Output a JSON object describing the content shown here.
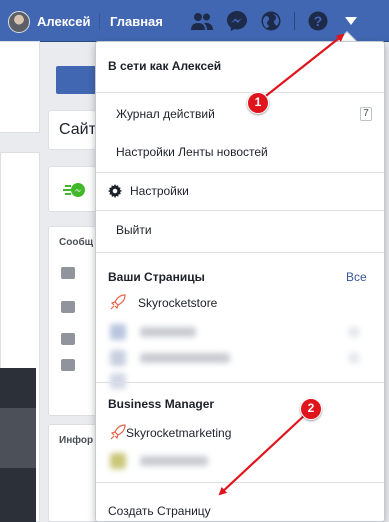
{
  "topbar": {
    "user_name": "Алексей",
    "home_label": "Главная",
    "icons": [
      "friends-icon",
      "messenger-icon",
      "globe-icon",
      "help-icon",
      "caret-down-icon"
    ]
  },
  "background": {
    "search_stub": "Сайт",
    "card_messages_stub": "Сообщ",
    "card_info_stub": "Инфор"
  },
  "menu": {
    "header": "В сети как Алексей",
    "items": [
      {
        "label": "Журнал действий",
        "badge": "7"
      },
      {
        "label": "Настройки Ленты новостей"
      },
      {
        "label": "Настройки",
        "icon": "gear-icon"
      },
      {
        "label": "Выйти"
      }
    ],
    "pages_section": {
      "title": "Ваши Страницы",
      "all_link": "Все",
      "pages": [
        {
          "name": "Skyrocketstore",
          "icon": "rocket-icon"
        }
      ]
    },
    "business_section": {
      "title": "Business Manager",
      "pages": [
        {
          "name": "Skyrocketmarketing",
          "icon": "rocket-icon"
        }
      ]
    },
    "create_page": "Создать Страницу"
  },
  "annotations": {
    "step1": "1",
    "step2": "2",
    "color": "#e0141d"
  },
  "colors": {
    "topbar": "#4267b2",
    "link": "#385898",
    "background": "#e9ebee"
  }
}
